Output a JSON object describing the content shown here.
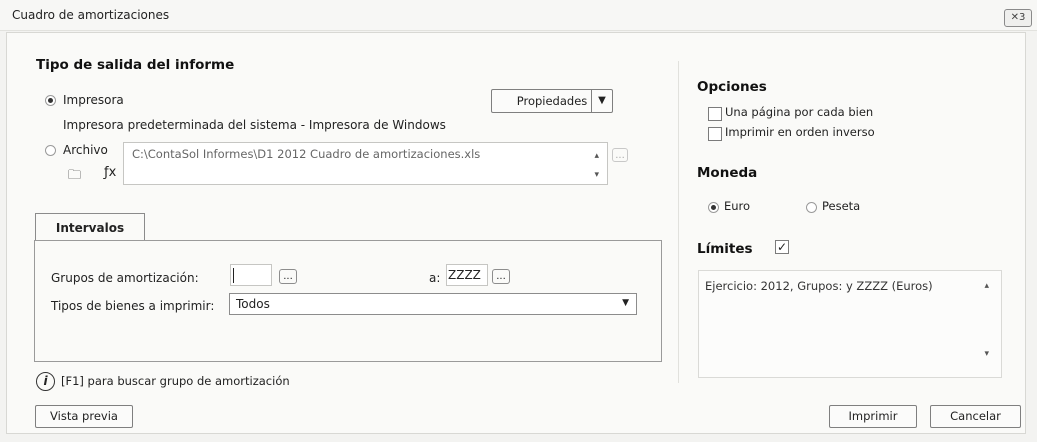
{
  "window": {
    "title": "Cuadro de amortizaciones",
    "close_glyph": "✕3"
  },
  "output": {
    "title": "Tipo de salida del informe",
    "printer_label": "Impresora",
    "printer_desc": "Impresora predeterminada del sistema - Impresora de Windows",
    "properties_label": "Propiedades",
    "file_label": "Archivo",
    "file_path": "C:\\ContaSol Informes\\D1 2012 Cuadro de amortizaciones.xls"
  },
  "intervals": {
    "tab_label": "Intervalos",
    "groups_label": "Grupos de amortización:",
    "from_value": "",
    "to_label": "a:",
    "to_value": "ZZZZ",
    "types_label": "Tipos de bienes a imprimir:",
    "types_value": "Todos"
  },
  "options": {
    "title": "Opciones",
    "one_page": "Una página por cada bien",
    "reverse": "Imprimir en orden inverso"
  },
  "currency": {
    "title": "Moneda",
    "euro": "Euro",
    "peseta": "Peseta"
  },
  "limits": {
    "title": "Límites",
    "checked": true,
    "summary": "Ejercicio: 2012, Grupos:  y ZZZZ (Euros)"
  },
  "footer": {
    "info_text": "[F1] para buscar grupo de amortización",
    "preview": "Vista previa",
    "print": "Imprimir",
    "cancel": "Cancelar"
  }
}
